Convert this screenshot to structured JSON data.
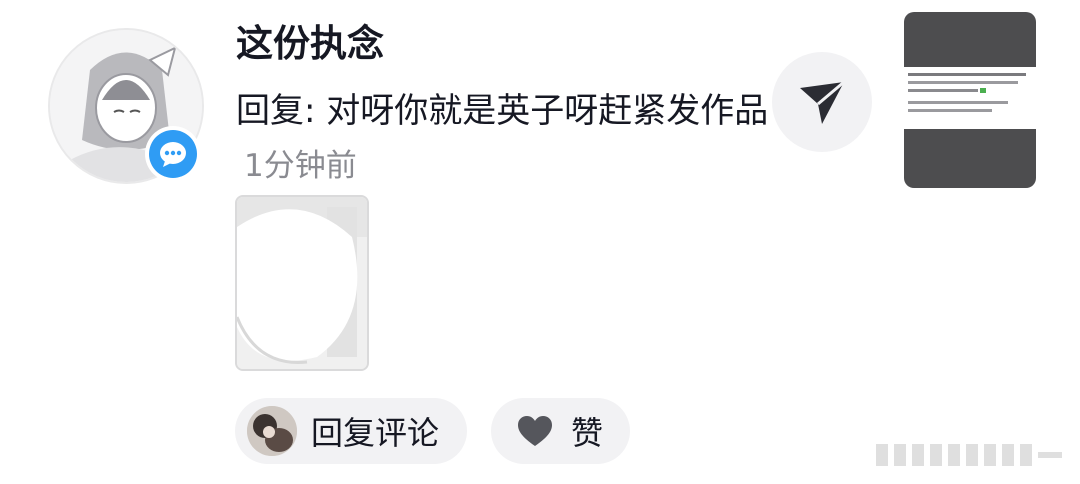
{
  "notification": {
    "username": "这份执念",
    "message": "回复: 对呀你就是英子呀赶紧发作品",
    "time_ago": "1分钟前"
  },
  "actions": {
    "reply_label": "回复评论",
    "like_label": "赞"
  },
  "icons": {
    "comment_badge": "chat-bubble-icon",
    "share": "send-arrow-icon",
    "like": "heart-icon"
  },
  "colors": {
    "badge_blue": "#2f9cf4",
    "time_gray": "#8a8b91",
    "pill_bg": "#f2f2f4"
  }
}
